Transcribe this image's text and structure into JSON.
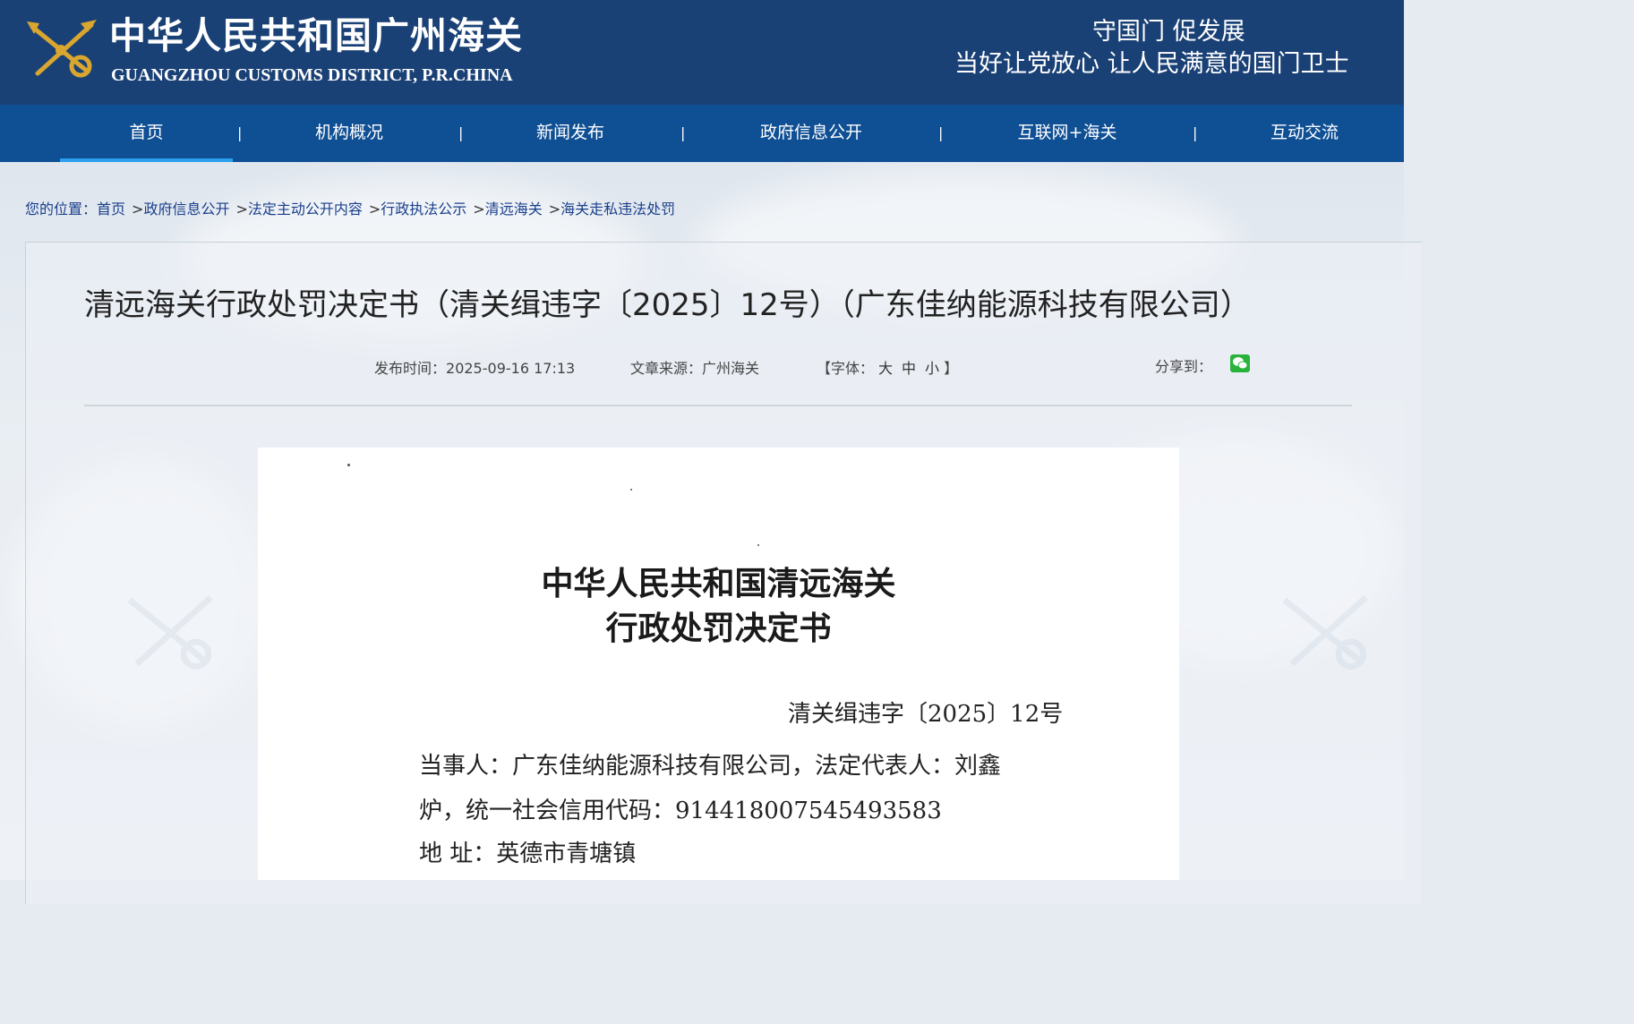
{
  "header": {
    "logo_cn": "中华人民共和国广州海关",
    "logo_en": "GUANGZHOU CUSTOMS DISTRICT, P.R.CHINA",
    "slogan_line1": "守国门  促发展",
    "slogan_line2": "当好让党放心  让人民满意的国门卫士"
  },
  "nav": {
    "items": [
      {
        "label": "首页"
      },
      {
        "label": "机构概况"
      },
      {
        "label": "新闻发布"
      },
      {
        "label": "政府信息公开"
      },
      {
        "label": "互联网+海关"
      },
      {
        "label": "互动交流"
      }
    ],
    "separator": "|"
  },
  "breadcrumb": {
    "prefix": "您的位置：",
    "items": [
      "首页",
      "政府信息公开",
      "法定主动公开内容",
      "行政执法公示",
      "清远海关",
      "海关走私违法处罚"
    ],
    "separator": ">"
  },
  "article": {
    "title": "清远海关行政处罚决定书（清关缉违字〔2025〕12号）（广东佳纳能源科技有限公司）",
    "publish_label": "发布时间：",
    "publish_time": "2025-09-16 17:13",
    "source_label": "文章来源：",
    "source": "广州海关",
    "font_label_open": "【字体：",
    "font_large": "大",
    "font_medium": "中",
    "font_small": "小",
    "font_label_close": "】",
    "share_label": "分享到：",
    "share_icon": "wechat-icon"
  },
  "document": {
    "heading_line1": "中华人民共和国清远海关",
    "heading_line2": "行政处罚决定书",
    "doc_number": "清关缉违字〔2025〕12号",
    "party_line1": "当事人：广东佳纳能源科技有限公司，法定代表人：刘鑫",
    "party_line2": "炉，统一社会信用代码：91441800754549358​3",
    "address_line": "地    址：英德市青塘镇"
  },
  "colors": {
    "header_bg": "#1a4176",
    "nav_bg": "#0f4f94",
    "nav_active_underline": "#2aa0ee",
    "link": "#1a3f8c",
    "wechat": "#2ab33b"
  }
}
